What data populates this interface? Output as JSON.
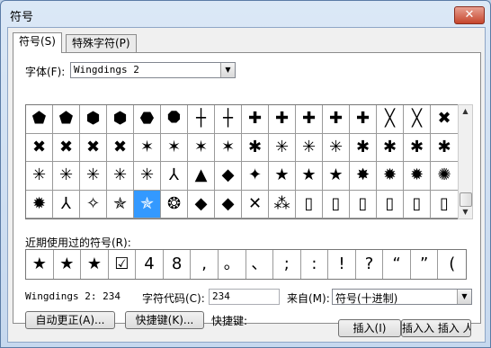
{
  "window": {
    "title": "符号",
    "close": "✕"
  },
  "tabs": [
    {
      "label": "符号(S)"
    },
    {
      "label": "特殊字符(P)"
    }
  ],
  "font": {
    "label": "字体(F):",
    "value": "Wingdings 2"
  },
  "symbols": [
    "⬟",
    "⬟",
    "⬢",
    "⬢",
    "⬣",
    "⯃",
    "┼",
    "┼",
    "✚",
    "✚",
    "✚",
    "✚",
    "✚",
    "╳",
    "╳",
    "✖",
    "✖",
    "✖",
    "✖",
    "✖",
    "✶",
    "✶",
    "✶",
    "✶",
    "✱",
    "✳",
    "✳",
    "✳",
    "✱",
    "✱",
    "✱",
    "✱",
    "✳",
    "✳",
    "✳",
    "✳",
    "✳",
    "⅄",
    "▲",
    "◆",
    "✦",
    "★",
    "★",
    "★",
    "✸",
    "✹",
    "✹",
    "✺",
    "✹",
    "⅄",
    "✧",
    "✯",
    "✯",
    "❂",
    "◆",
    "◆",
    "✕",
    "⁂",
    "▯",
    "▯",
    "▯",
    "▯",
    "▯",
    "▯"
  ],
  "selected_index": 52,
  "recent": {
    "label": "近期使用过的符号(R):",
    "items": [
      "★",
      "★",
      "★",
      "☑",
      "4",
      "8",
      ",",
      "。",
      "、",
      ";",
      ":",
      "!",
      "?",
      "“",
      "”",
      "("
    ]
  },
  "status": {
    "font_code": "Wingdings 2: 234"
  },
  "char_code": {
    "label": "字符代码(C):",
    "value": "234"
  },
  "from": {
    "label": "来自(M):",
    "value": "符号(十进制)"
  },
  "buttons": {
    "autocorrect": "自动更正(A)...",
    "shortcut_key": "快捷键(K)...",
    "shortcut_label": "快捷键:",
    "insert": "插入(I)",
    "cancel": "插入入 插入 人 入 埴"
  },
  "colors": {
    "selection": "#3399ff"
  }
}
